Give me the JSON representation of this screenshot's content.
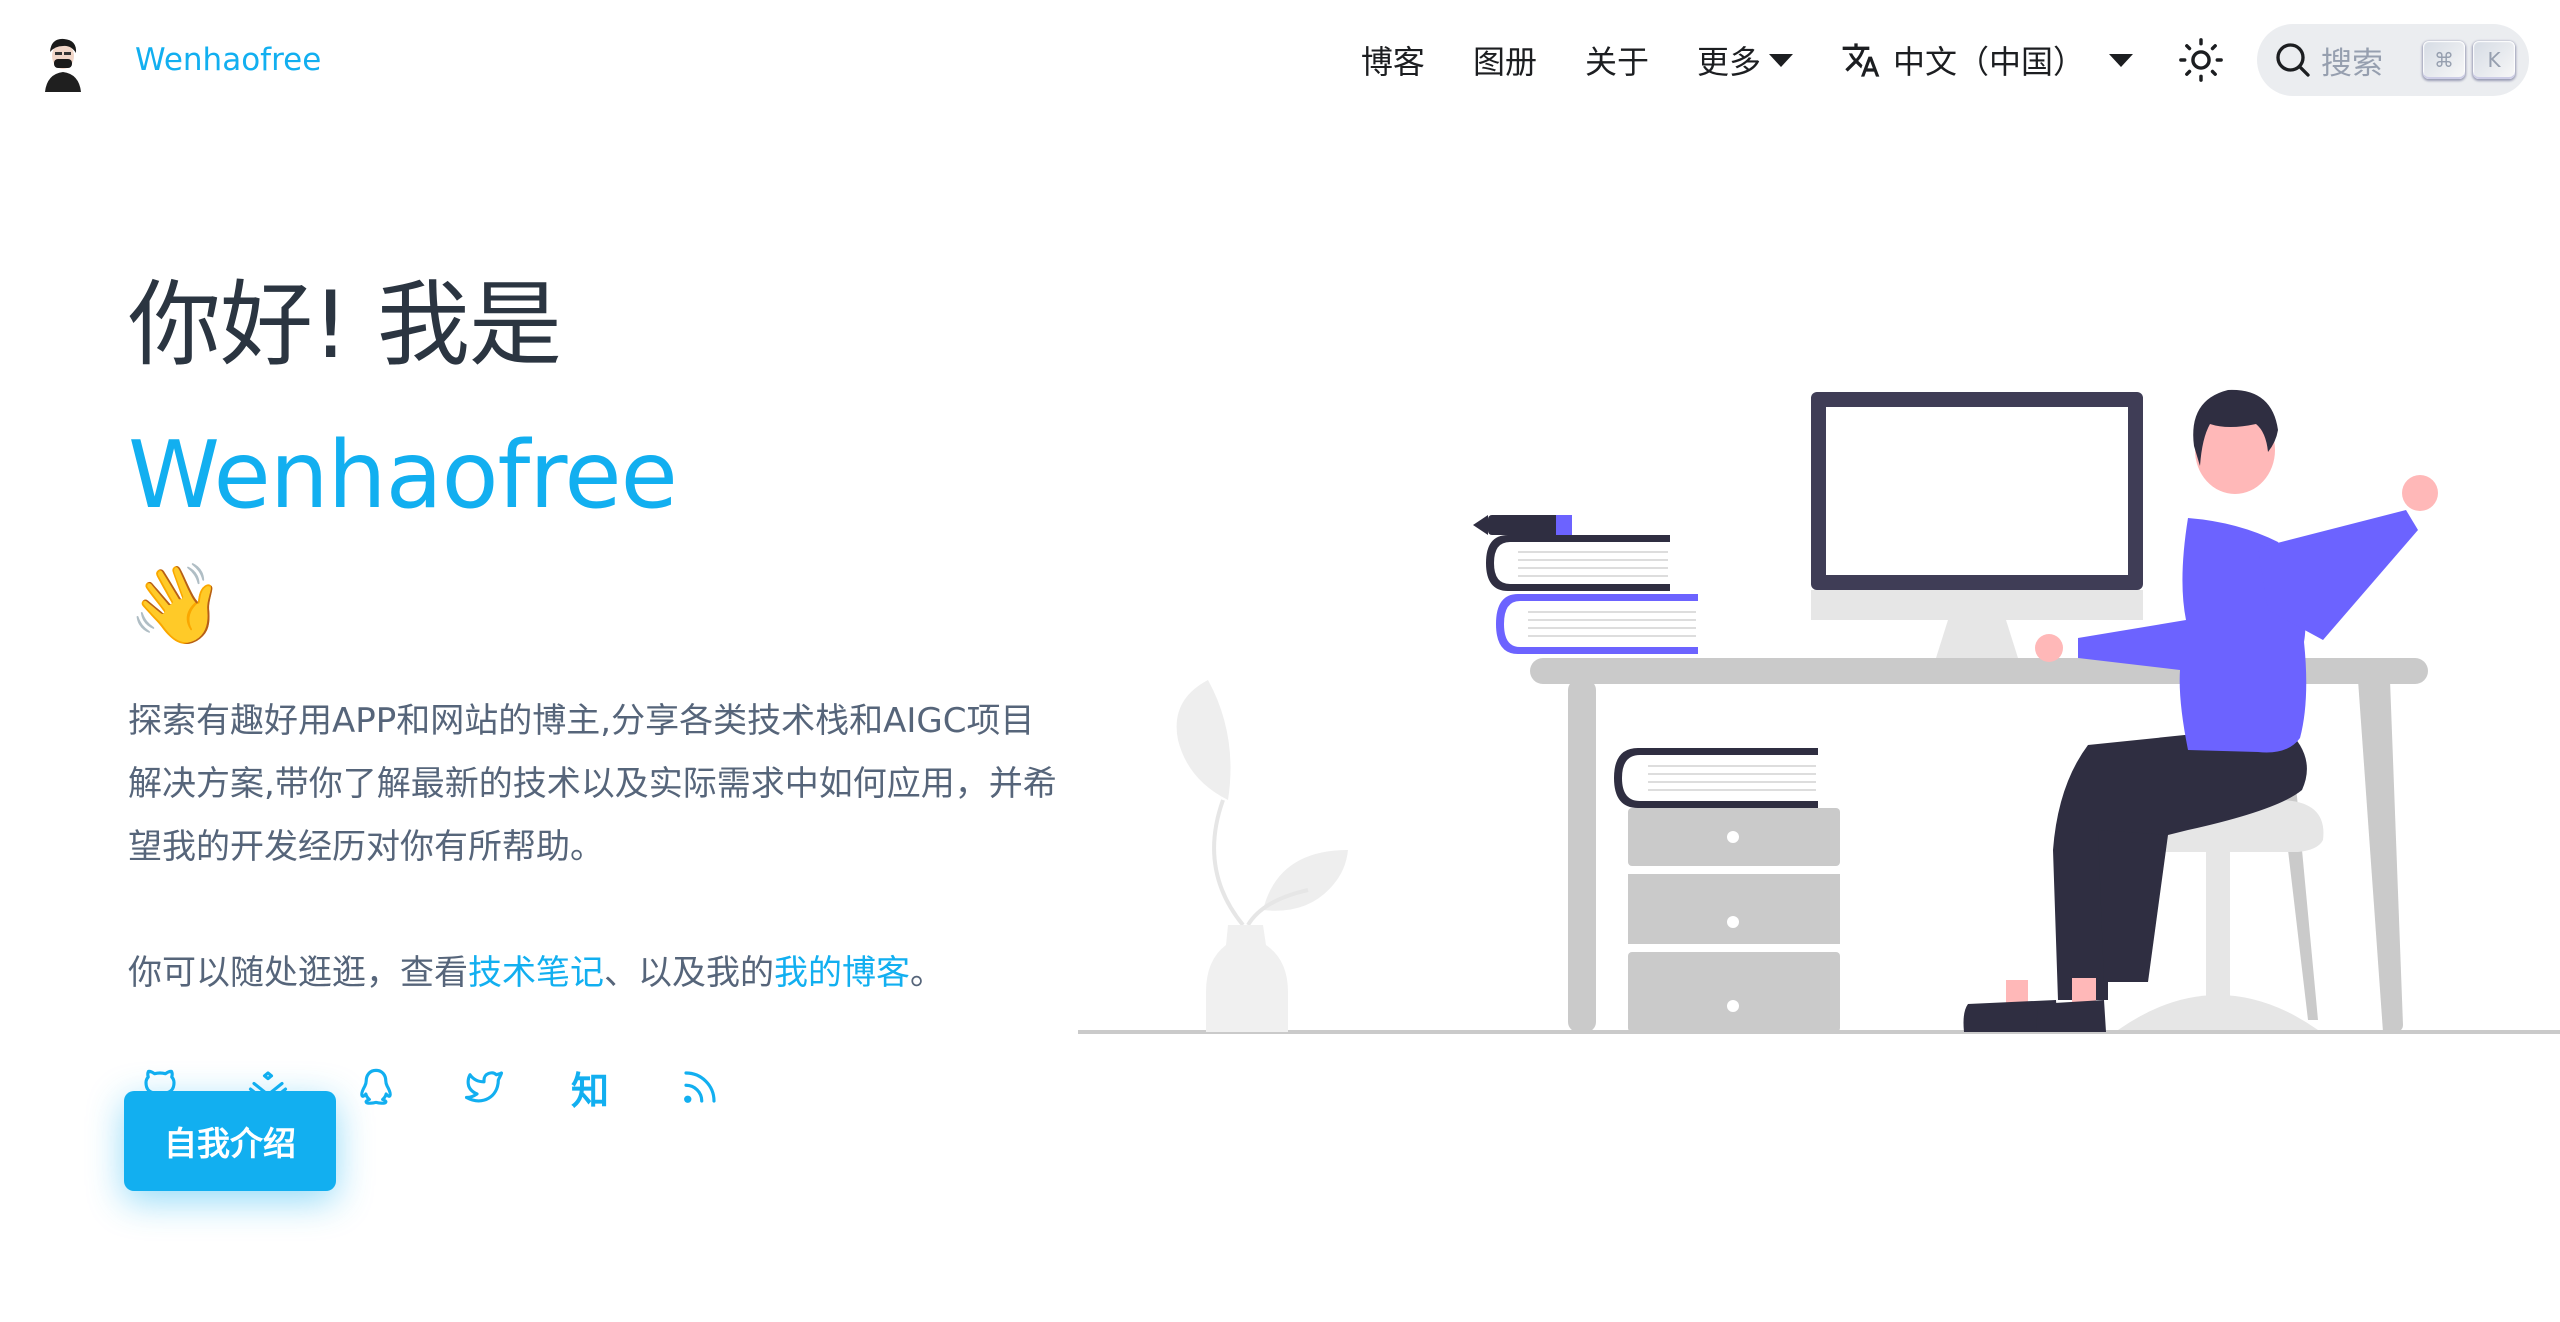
{
  "navbar": {
    "title": "Wenhaofree",
    "links": [
      {
        "label": "博客"
      },
      {
        "label": "图册"
      },
      {
        "label": "关于"
      },
      {
        "label": "更多"
      }
    ],
    "language": "中文（中国）",
    "search": {
      "label": "搜索",
      "key_mod": "⌘",
      "key_char": "K"
    }
  },
  "hero": {
    "greeting": "你好! 我是",
    "name": "Wenhaofree",
    "wave": "👋",
    "description": "探索有趣好用APP和网站的博主,分享各类技术栈和AIGC项目解决方案,带你了解最新的技术以及实际需求中如何应用，并希望我的开发经历对你有所帮助。",
    "sub_prefix": "你可以随处逛逛，查看",
    "sub_link1": "技术笔记",
    "sub_middle": "、以及我的",
    "sub_link2": "我的博客",
    "sub_suffix": "。",
    "social": [
      {
        "icon": "github-icon"
      },
      {
        "icon": "juejin-icon"
      },
      {
        "icon": "qq-icon"
      },
      {
        "icon": "twitter-icon"
      },
      {
        "icon": "zhihu-icon",
        "text": "知"
      },
      {
        "icon": "rss-icon"
      }
    ],
    "cta_label": "自我介绍"
  },
  "colors": {
    "accent": "#12aff0",
    "heading": "#2b3541",
    "body_text": "#56657a",
    "illustration_purple": "#6c63ff",
    "illustration_dark": "#2f2e41"
  }
}
